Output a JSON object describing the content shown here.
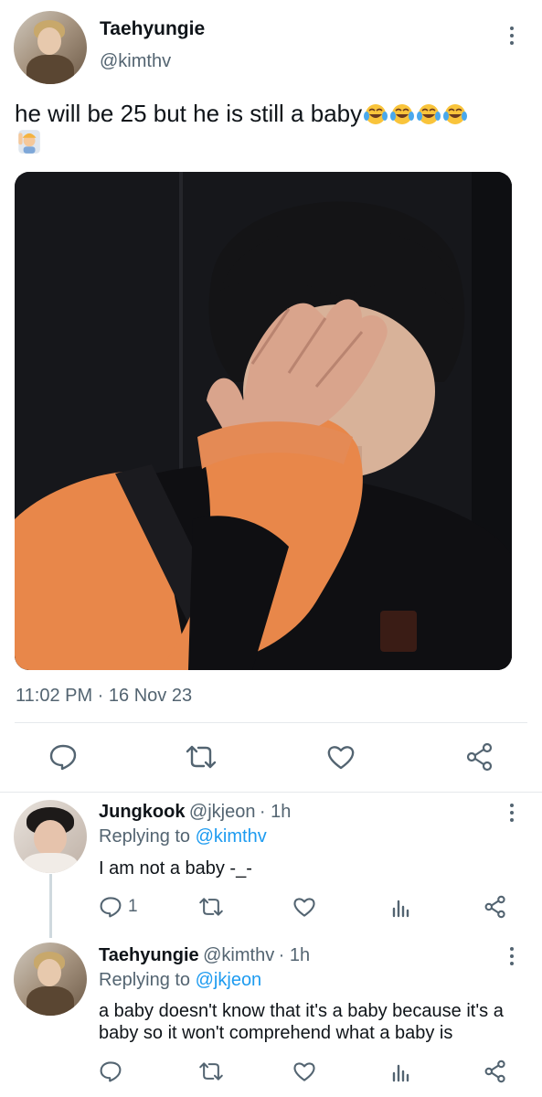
{
  "main_tweet": {
    "display_name": "Taehyungie",
    "handle": "@kimthv",
    "text": "he will be 25 but he is still a baby",
    "emojis": [
      "face-with-tears-of-joy",
      "face-with-tears-of-joy",
      "face-with-tears-of-joy",
      "face-with-tears-of-joy",
      "person-raising-hand"
    ],
    "timestamp": "11:02 PM · 16 Nov 23",
    "image_icon": "photo"
  },
  "actions": {
    "reply_icon": "comment-icon",
    "retweet_icon": "retweet-icon",
    "like_icon": "heart-icon",
    "share_icon": "share-icon"
  },
  "replies": [
    {
      "display_name": "Jungkook",
      "handle": "@jkjeon",
      "time": "· 1h",
      "replying_label": "Replying to",
      "replying_to": "@kimthv",
      "text": "I am not a baby -_-",
      "reply_count": "1"
    },
    {
      "display_name": "Taehyungie",
      "handle": "@kimthv",
      "time": "· 1h",
      "replying_label": "Replying to",
      "replying_to": "@jkjeon",
      "text": "a baby doesn't know that it's a baby because it's a baby so it won't comprehend what a baby is"
    }
  ],
  "colors": {
    "link": "#1d9bf0",
    "secondary_text": "#536471",
    "orange_sleeve": "#e8874a"
  }
}
